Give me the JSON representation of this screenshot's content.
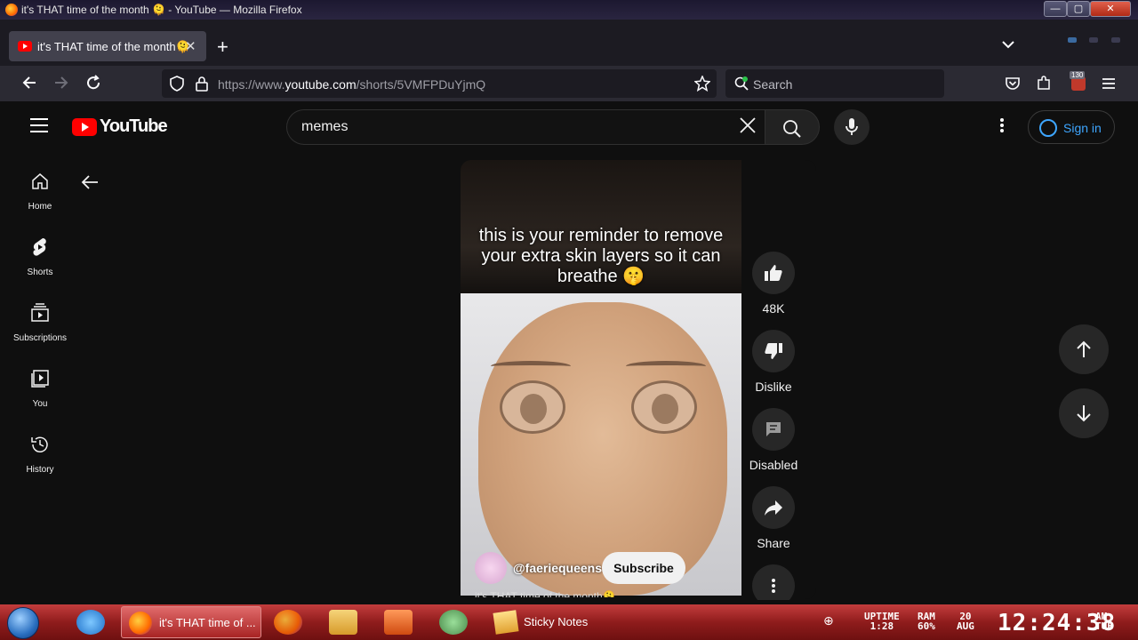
{
  "window": {
    "title": "it's THAT time of the month 🫠 - YouTube — Mozilla Firefox",
    "min": "—",
    "max": "▢",
    "close": "✕"
  },
  "tab": {
    "label": "it's THAT time of the month🫠",
    "close": "✕",
    "new_tab": "+"
  },
  "nav": {
    "url_prefix": "https://www.",
    "url_domain": "youtube.com",
    "url_path": "/shorts/5VMFPDuYjmQ",
    "search_placeholder": "Search",
    "extension_badge": "130"
  },
  "youtube": {
    "logo_text": "YouTube",
    "search_value": "memes",
    "sign_in": "Sign in",
    "guide": [
      {
        "label": "Home",
        "icon": "home-icon"
      },
      {
        "label": "Shorts",
        "icon": "shorts-icon"
      },
      {
        "label": "Subscriptions",
        "icon": "subscriptions-icon"
      },
      {
        "label": "You",
        "icon": "you-icon"
      },
      {
        "label": "History",
        "icon": "history-icon"
      }
    ],
    "short": {
      "caption": "this is your reminder to remove your extra skin layers so it can breathe 🤫",
      "channel": "@faeriequeens",
      "subscribe": "Subscribe",
      "title_peek": "it's THAT time of the month🫠"
    },
    "actions": {
      "like_count": "48K",
      "dislike": "Dislike",
      "comments": "Disabled",
      "share": "Share"
    }
  },
  "taskbar": {
    "firefox_button": "it's THAT time of ...",
    "sticky_notes": "Sticky Notes",
    "uptime_label": "UPTIME",
    "uptime_value": "1:28",
    "ram_label": "RAM",
    "ram_value": "60%",
    "date_day": "20",
    "date_month": "AUG",
    "clock": "12:24:38",
    "ampm": "AM",
    "weekday": "TUE"
  }
}
